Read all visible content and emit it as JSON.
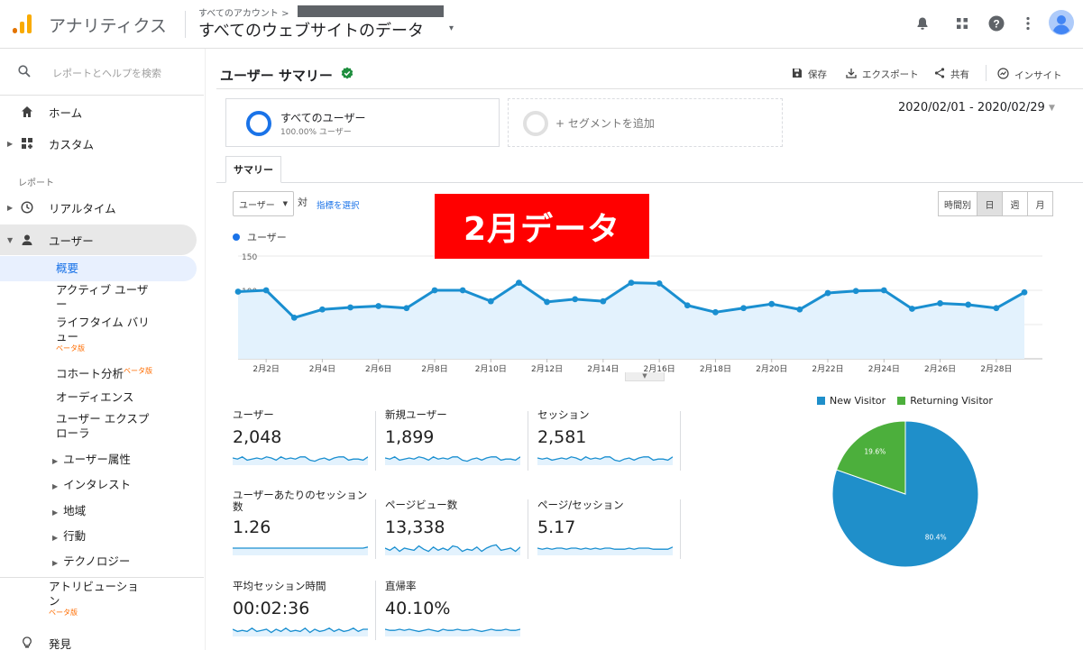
{
  "header": {
    "app_title": "アナリティクス",
    "account_crumb": "すべてのアカウント >",
    "property_title": "すべてのウェブサイトのデータ",
    "property_caret": "▾"
  },
  "sidebar": {
    "search_placeholder": "レポートとヘルプを検索",
    "home": "ホーム",
    "custom": "カスタム",
    "section_reports": "レポート",
    "realtime": "リアルタイム",
    "users": "ユーザー",
    "sub_items": {
      "overview": "概要",
      "active_users_1": "アクティブ ユーザ",
      "active_users_2": "ー",
      "lifetime_1": "ライフタイム バリ",
      "lifetime_2": "ュー",
      "lifetime_beta": "ベータ版",
      "cohort": "コホート分析",
      "cohort_beta": "ベータ版",
      "audiences": "オーディエンス",
      "explorer_1": "ユーザー エクスプ",
      "explorer_2": "ローラ",
      "demographics": "ユーザー属性",
      "interests": "インタレスト",
      "geo": "地域",
      "behavior": "行動",
      "technology": "テクノロジー"
    },
    "attribution_1": "アトリビューショ",
    "attribution_2": "ン",
    "attribution_beta": "ベータ版",
    "discover": "発見"
  },
  "main": {
    "page_title": "ユーザー サマリー",
    "actions": {
      "save": "保存",
      "export": "エクスポート",
      "share": "共有",
      "insights": "インサイト"
    },
    "segment_all_name": "すべてのユーザー",
    "segment_all_pct": "100.00% ユーザー",
    "segment_add": "+ セグメントを追加",
    "date_range": "2020/02/01 - 2020/02/29",
    "tab_summary": "サマリー",
    "metric_select": "ユーザー",
    "vs_label": "対",
    "choose_metric": "指標を選択",
    "granularity": [
      "時間別",
      "日",
      "週",
      "月"
    ],
    "granularity_active": "日",
    "banner": "2月データ",
    "legend_label": "ユーザー"
  },
  "kpis": [
    {
      "name": "ユーザー",
      "value": "2,048"
    },
    {
      "name": "新規ユーザー",
      "value": "1,899"
    },
    {
      "name": "セッション",
      "value": "2,581"
    },
    {
      "name": "ユーザーあたりのセッション数",
      "value": "1.26"
    },
    {
      "name": "ページビュー数",
      "value": "13,338"
    },
    {
      "name": "ページ/セッション",
      "value": "5.17"
    },
    {
      "name": "平均セッション時間",
      "value": "00:02:36"
    },
    {
      "name": "直帰率",
      "value": "40.10%"
    }
  ],
  "chart_data": [
    {
      "type": "line",
      "title": "",
      "series": [
        {
          "name": "ユーザー",
          "values": [
            98,
            100,
            60,
            72,
            75,
            77,
            74,
            100,
            100,
            84,
            111,
            83,
            87,
            84,
            111,
            110,
            78,
            68,
            74,
            80,
            72,
            96,
            99,
            100,
            73,
            81,
            79,
            74,
            97
          ]
        }
      ],
      "x": [
        "2月1日",
        "2月2日",
        "2月3日",
        "2月4日",
        "2月5日",
        "2月6日",
        "2月7日",
        "2月8日",
        "2月9日",
        "2月10日",
        "2月11日",
        "2月12日",
        "2月13日",
        "2月14日",
        "2月15日",
        "2月16日",
        "2月17日",
        "2月18日",
        "2月19日",
        "2月20日",
        "2月21日",
        "2月22日",
        "2月23日",
        "2月24日",
        "2月25日",
        "2月26日",
        "2月27日",
        "2月28日",
        "2月29日"
      ],
      "x_tick_labels": [
        "2月2日",
        "2月4日",
        "2月6日",
        "2月8日",
        "2月10日",
        "2月12日",
        "2月14日",
        "2月16日",
        "2月18日",
        "2月20日",
        "2月22日",
        "2月24日",
        "2月26日",
        "2月28日"
      ],
      "y_tick_labels": [
        "150",
        "100",
        "50"
      ],
      "ylim": [
        0,
        150
      ],
      "color": "#1a8fd0",
      "fill": "#e3f2fd"
    },
    {
      "type": "pie",
      "categories": [
        "New Visitor",
        "Returning Visitor"
      ],
      "values": [
        80.4,
        19.6
      ],
      "labels": [
        "80.4%",
        "19.6%"
      ],
      "colors": [
        "#1f8fca",
        "#4caf3c"
      ],
      "legend": "top"
    }
  ],
  "sparklines": [
    [
      5,
      4,
      6,
      3,
      4,
      5,
      4,
      6,
      5,
      3,
      6,
      4,
      5,
      4,
      6,
      6,
      3,
      2,
      4,
      5,
      3,
      5,
      6,
      6,
      3,
      4,
      4,
      3,
      6
    ],
    [
      5,
      4,
      6,
      3,
      4,
      5,
      4,
      6,
      5,
      3,
      6,
      4,
      5,
      4,
      6,
      6,
      3,
      2,
      4,
      5,
      3,
      5,
      6,
      6,
      3,
      4,
      4,
      3,
      6
    ],
    [
      5,
      4,
      5,
      3,
      4,
      5,
      4,
      6,
      5,
      3,
      6,
      4,
      5,
      4,
      6,
      6,
      3,
      2,
      4,
      5,
      3,
      5,
      6,
      6,
      3,
      4,
      4,
      3,
      6
    ],
    [
      5,
      5,
      5,
      5,
      5,
      5,
      5,
      5,
      5,
      5,
      5,
      5,
      5,
      5,
      5,
      5,
      5,
      5,
      5,
      5,
      5,
      5,
      5,
      5,
      5,
      5,
      5,
      5,
      6
    ],
    [
      5,
      3,
      6,
      2,
      5,
      4,
      3,
      7,
      4,
      2,
      6,
      3,
      5,
      3,
      7,
      6,
      2,
      4,
      3,
      6,
      2,
      5,
      7,
      8,
      3,
      4,
      5,
      2,
      6
    ],
    [
      5,
      4,
      5,
      4,
      5,
      5,
      4,
      5,
      5,
      4,
      5,
      4,
      5,
      4,
      5,
      5,
      4,
      4,
      4,
      5,
      4,
      5,
      5,
      5,
      4,
      4,
      4,
      4,
      6
    ],
    [
      5,
      3,
      4,
      3,
      6,
      3,
      4,
      5,
      2,
      5,
      3,
      6,
      3,
      4,
      3,
      6,
      2,
      5,
      3,
      4,
      6,
      3,
      5,
      3,
      4,
      6,
      3,
      5,
      5
    ],
    [
      5,
      4,
      4,
      5,
      4,
      5,
      4,
      3,
      4,
      5,
      4,
      3,
      5,
      4,
      4,
      5,
      4,
      4,
      5,
      4,
      3,
      4,
      5,
      4,
      4,
      5,
      4,
      4,
      5
    ]
  ],
  "colors": {
    "accent": "#1a73e8",
    "line": "#1a8fd0",
    "banner": "#ff0000",
    "new_visitor": "#1f8fca",
    "returning_visitor": "#4caf3c"
  },
  "icons": [
    "analytics-logo",
    "search-icon",
    "home-icon",
    "custom-icon",
    "clock-icon",
    "person-icon",
    "bulb-icon",
    "bell-icon",
    "apps-icon",
    "help-icon",
    "more-icon",
    "avatar",
    "save-icon",
    "export-icon",
    "share-icon",
    "insights-icon",
    "verified-icon"
  ]
}
